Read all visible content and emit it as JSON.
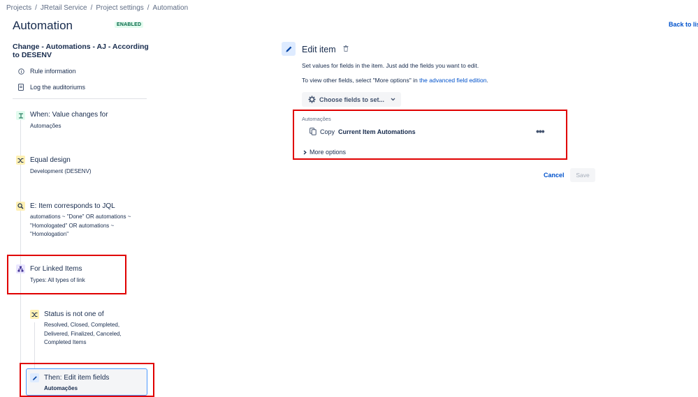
{
  "breadcrumb": {
    "items": [
      "Projects",
      "JRetail Service",
      "Project settings",
      "Automation"
    ],
    "separator": "/"
  },
  "header": {
    "title": "Automation",
    "badge": "ENABLED",
    "back_link": "Back to lis"
  },
  "rule": {
    "name": "Change - Automations - AJ - According to DESENV",
    "links": [
      {
        "label": "Rule information",
        "icon": "info-icon"
      },
      {
        "label": "Log the auditoriums",
        "icon": "document-icon"
      }
    ]
  },
  "steps": [
    {
      "title": "When: Value changes for",
      "sub": "Automações",
      "icon": "trigger-icon"
    },
    {
      "title": "Equal design",
      "sub": "Development (DESENV)",
      "icon": "branch-icon"
    },
    {
      "title": "E: Item corresponds to JQL",
      "sub": "automations ~ \"Done\" OR automations ~ \"Homologated\" OR automations ~ \"Homologation\"",
      "icon": "search-icon"
    },
    {
      "title": "For Linked Items",
      "sub": "Types: All types of link",
      "icon": "hierarchy-icon"
    },
    {
      "title": "Status is not one of",
      "sub": "Resolved, Closed, Completed, Delivered, Finalized, Canceled, Completed Items",
      "icon": "branch-icon"
    },
    {
      "title": "Then: Edit item fields",
      "sub": "Automações",
      "icon": "pencil-icon"
    }
  ],
  "editor": {
    "title": "Edit item",
    "desc1": "Set values for fields in the item. Just add the fields you want to edit.",
    "desc2_prefix": "To view other fields, select \"More options\" in ",
    "desc2_link": "the advanced field edition",
    "desc2_suffix": ".",
    "choose_fields": "Choose fields to set...",
    "field_label": "Automações",
    "copy_prefix": "Copy",
    "copy_value": "Current Item Automations",
    "more_options": "More options",
    "cancel": "Cancel",
    "save": "Save"
  },
  "colors": {
    "accent": "#0052cc",
    "highlight_box": "#e00000",
    "badge_bg": "#e3fcef",
    "badge_text": "#006644"
  }
}
